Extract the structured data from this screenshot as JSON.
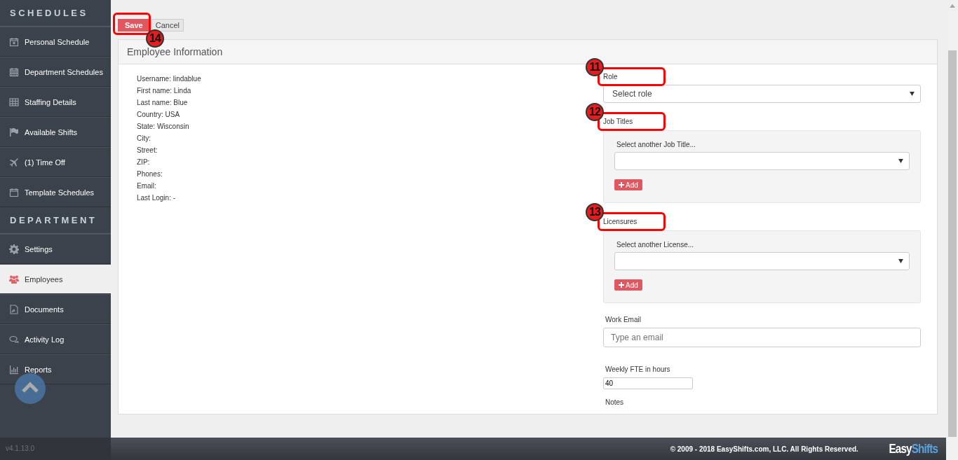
{
  "sidebar": {
    "sections": [
      {
        "title": "SCHEDULES",
        "items": [
          {
            "label": "Personal Schedule",
            "selected": false
          },
          {
            "label": "Department Schedules",
            "selected": false
          },
          {
            "label": "Staffing Details",
            "selected": false
          },
          {
            "label": "Available Shifts",
            "selected": false
          },
          {
            "label": "(1) Time Off",
            "selected": false
          },
          {
            "label": "Template Schedules",
            "selected": false
          }
        ]
      },
      {
        "title": "DEPARTMENT",
        "items": [
          {
            "label": "Settings",
            "selected": false
          },
          {
            "label": "Employees",
            "selected": true
          },
          {
            "label": "Documents",
            "selected": false
          },
          {
            "label": "Activity Log",
            "selected": false
          },
          {
            "label": "Reports",
            "selected": false
          }
        ]
      }
    ],
    "version": "v4.1.13.0"
  },
  "toolbar": {
    "save": {
      "label": "Save",
      "callout": "14"
    },
    "cancel": "Cancel"
  },
  "panel": {
    "title": "Employee Information",
    "info": [
      "Username: lindablue",
      "First name: Linda",
      "Last name: Blue",
      "Country: USA",
      "State: Wisconsin",
      "City:",
      "Street:",
      "ZIP:",
      "Phones:",
      "Email:",
      "Last Login: -"
    ],
    "fields": [
      {
        "kind": "select",
        "label": "Role",
        "callout": "11",
        "value": "Select role"
      },
      {
        "kind": "group",
        "label": "Job Titles",
        "callout": "12",
        "hint": "Select another Job Title...",
        "button": "Add"
      },
      {
        "kind": "group",
        "label": "Licensures",
        "callout": "13",
        "hint": "Select another License...",
        "button": "Add"
      },
      {
        "kind": "text",
        "label": "Work Email",
        "placeholder": "Type an email"
      },
      {
        "kind": "small",
        "label": "Weekly FTE in hours",
        "value": "40"
      },
      {
        "kind": "label",
        "label": "Notes"
      }
    ]
  },
  "footer": {
    "copyright": "© 2009 - 2018 EasyShifts.com, LLC. All Rights Reserved.",
    "logo": [
      "Easy",
      "Shifts"
    ]
  }
}
